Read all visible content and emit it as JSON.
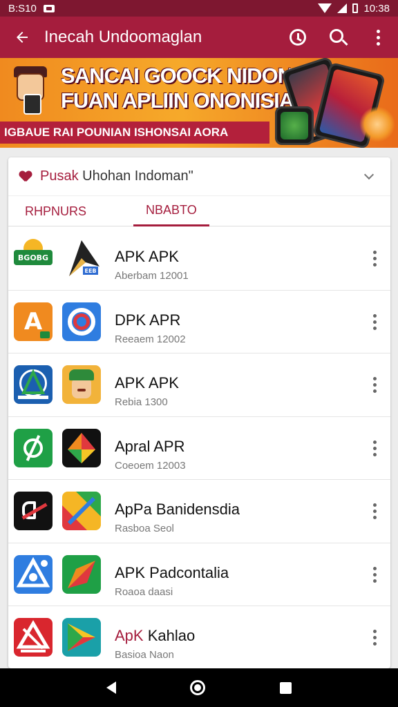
{
  "status_bar": {
    "time_left": "B:S10",
    "time_right": "10:38"
  },
  "app_bar": {
    "title": "Inecah Undoomaglan"
  },
  "banner": {
    "headline_line1": "SANCAI GOOCK NIDONSAN",
    "headline_line2": "FUAN APLIIN ONONISIAI",
    "strip_text": "IGBAUE RAI POUNIAN ISHONSAI AORA"
  },
  "card": {
    "header_accent": "Pusak",
    "header_text": "Uhohan Indoman\"",
    "tabs": [
      {
        "label": "RHPNURS"
      },
      {
        "label": "NBABTO"
      }
    ]
  },
  "apps": [
    {
      "name": "APK APK",
      "sub": "Aberbam 12001",
      "icon1_label": "BGOBG",
      "icon2_label": "EEB"
    },
    {
      "name": "DPK APR",
      "sub": "Reeaem 12002",
      "icon1_label": "A",
      "icon2_label": ""
    },
    {
      "name": "APK APK",
      "sub": "Rebia 1300",
      "icon1_label": "",
      "icon2_label": ""
    },
    {
      "name": "Apral APR",
      "sub": "Coeoem 12003",
      "icon1_label": "",
      "icon2_label": ""
    },
    {
      "name": "ApPa Banidensdia",
      "sub": "Rasboa Seol",
      "icon1_label": "",
      "icon2_label": ""
    },
    {
      "name": "APK Padcontalia",
      "sub": "Roaoa daasi",
      "icon1_label": "",
      "icon2_label": ""
    },
    {
      "name_accent": "ApK",
      "name": "Kahlao",
      "sub": "Basioa Naon",
      "icon1_label": "",
      "icon2_label": ""
    }
  ],
  "colors": {
    "primary": "#a51d3d",
    "status": "#7e1730",
    "banner": "#f6a92a"
  },
  "icons": [
    "back-arrow-icon",
    "history-icon",
    "search-icon",
    "more-vert-icon",
    "heart-icon",
    "chevron-down-icon"
  ]
}
